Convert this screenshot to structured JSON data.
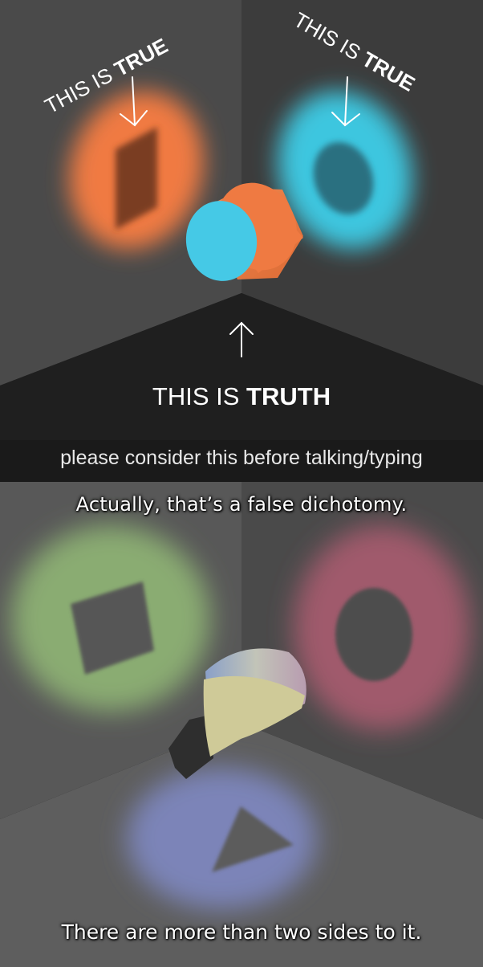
{
  "top_panel": {
    "left_label": {
      "prefix": "THIS IS ",
      "emphasis": "TRUE"
    },
    "right_label": {
      "prefix": "THIS IS ",
      "emphasis": "TRUE"
    },
    "center_label": {
      "prefix": "THIS IS ",
      "emphasis": "TRUTH"
    },
    "plea": "please consider this before talking/typing",
    "colors": {
      "left_glow": "#f07a43",
      "right_glow": "#3ec6df",
      "cylinder_side": "#ef7a42",
      "cylinder_face": "#45c9e6"
    }
  },
  "bottom_panel": {
    "caption_top": "Actually, that’s a false dichotomy.",
    "caption_bottom": "There are more than two sides to it.",
    "colors": {
      "green_glow": "#8aac72",
      "red_glow": "#a05a6c",
      "blue_glow": "#7c84b8"
    }
  }
}
